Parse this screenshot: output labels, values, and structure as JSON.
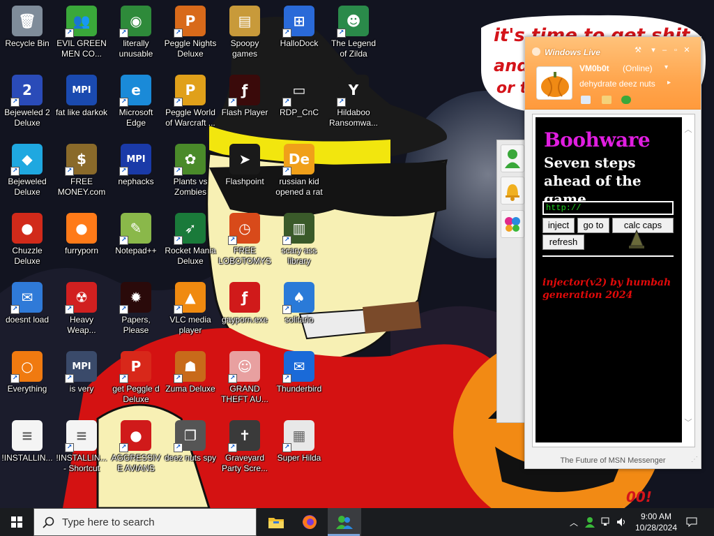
{
  "wallpaper": {
    "text": "it's time to get shit",
    "text_partial_1": "and",
    "text_partial_2": "or t",
    "halloween_text": "00!"
  },
  "desktop_icons": [
    {
      "label": "Recycle Bin",
      "icon": "recycle-bin-icon",
      "color": "#7f8c9a",
      "symbol": "🗑",
      "shortcut": false
    },
    {
      "label": "Bejeweled 2 Deluxe",
      "icon": "bejeweled-2-icon",
      "color": "#2a4bb8",
      "symbol": "2",
      "shortcut": true
    },
    {
      "label": "Bejeweled Deluxe",
      "icon": "bejeweled-icon",
      "color": "#1fa8e0",
      "symbol": "◆",
      "shortcut": true
    },
    {
      "label": "Chuzzle Deluxe",
      "icon": "chuzzle-icon",
      "color": "#d12a1a",
      "symbol": "●",
      "shortcut": false
    },
    {
      "label": "doesnt load",
      "icon": "thunderbird-icon",
      "color": "#2f7ad8",
      "symbol": "✉",
      "shortcut": true
    },
    {
      "label": "Everything",
      "icon": "everything-search-icon",
      "color": "#f07a10",
      "symbol": "○",
      "shortcut": true
    },
    {
      "label": "!INSTALLIN...",
      "icon": "text-file-icon",
      "color": "#f4f4f4",
      "symbol": "≡",
      "shortcut": false
    },
    {
      "label": "EVIL GREEN MEN CO...",
      "icon": "msn-people-icon",
      "color": "#3aa83a",
      "symbol": "👥",
      "shortcut": true
    },
    {
      "label": "fat like darkok",
      "icon": "mpi-icon",
      "color": "#1a4ab0",
      "symbol": "MPI",
      "shortcut": false
    },
    {
      "label": "FREE MONEY.com",
      "icon": "money-bag-icon",
      "color": "#8a6a2a",
      "symbol": "$",
      "shortcut": true
    },
    {
      "label": "furryporn",
      "icon": "firefox-icon",
      "color": "#ff7a18",
      "symbol": "●",
      "shortcut": false
    },
    {
      "label": "Heavy Weap...",
      "icon": "radiation-icon",
      "color": "#d12020",
      "symbol": "☢",
      "shortcut": true
    },
    {
      "label": "is very",
      "icon": "mpi-shield-icon",
      "color": "#3a4a6a",
      "symbol": "MPI",
      "shortcut": true
    },
    {
      "label": "!INSTALLIN... - Shortcut",
      "icon": "text-file-shortcut-icon",
      "color": "#f4f4f4",
      "symbol": "≡",
      "shortcut": true
    },
    {
      "label": "literally unusable",
      "icon": "chrome-icon",
      "color": "#2e8a3a",
      "symbol": "◉",
      "shortcut": true
    },
    {
      "label": "Microsoft Edge",
      "icon": "edge-icon",
      "color": "#1a8ad8",
      "symbol": "e",
      "shortcut": true
    },
    {
      "label": "nephacks",
      "icon": "mpi-logo-icon",
      "color": "#1a3aa8",
      "symbol": "MPI",
      "shortcut": true
    },
    {
      "label": "Notepad++",
      "icon": "notepad-plus-icon",
      "color": "#8ab84a",
      "symbol": "✎",
      "shortcut": true
    },
    {
      "label": "Papers, Please",
      "icon": "papers-please-icon",
      "color": "#2a0a0a",
      "symbol": "✹",
      "shortcut": true
    },
    {
      "label": "get Peggle d Deluxe",
      "icon": "peggle-icon",
      "color": "#d8281a",
      "symbol": "P",
      "shortcut": true
    },
    {
      "label": "AGGRESSIVE AVIANS",
      "icon": "angry-birds-icon",
      "color": "#d01a1a",
      "symbol": "●",
      "shortcut": true
    },
    {
      "label": "Peggle Nights Deluxe",
      "icon": "peggle-nights-icon",
      "color": "#d86a1a",
      "symbol": "P",
      "shortcut": true
    },
    {
      "label": "Peggle World of Warcraft ...",
      "icon": "peggle-wow-icon",
      "color": "#e0a01a",
      "symbol": "P",
      "shortcut": true
    },
    {
      "label": "Plants vs Zombies",
      "icon": "plants-vs-zombies-icon",
      "color": "#4a8a2a",
      "symbol": "✿",
      "shortcut": true
    },
    {
      "label": "Rocket Mania Deluxe",
      "icon": "rocket-mania-icon",
      "color": "#1a7a3a",
      "symbol": "➶",
      "shortcut": true
    },
    {
      "label": "VLC media player",
      "icon": "vlc-icon",
      "color": "#f08a10",
      "symbol": "▲",
      "shortcut": true
    },
    {
      "label": "Zuma Deluxe",
      "icon": "zuma-icon",
      "color": "#c86a1a",
      "symbol": "☗",
      "shortcut": true
    },
    {
      "label": "deez nuts spy",
      "icon": "stacked-windows-icon",
      "color": "#555555",
      "symbol": "❐",
      "shortcut": true
    },
    {
      "label": "Spoopy games",
      "icon": "games-folder-icon",
      "color": "#c89a3a",
      "symbol": "▤",
      "shortcut": false
    },
    {
      "label": "Flash Player",
      "icon": "flash-player-icon",
      "color": "#3a0a0a",
      "symbol": "ƒ",
      "shortcut": true
    },
    {
      "label": "Flashpoint",
      "icon": "flashpoint-icon",
      "color": "#1a1a1a",
      "symbol": "➤",
      "shortcut": false
    },
    {
      "label": "FREE LOBOTOMYS",
      "icon": "clock-icon",
      "color": "#d84a1a",
      "symbol": "◷",
      "shortcut": true
    },
    {
      "label": "gayporn.exe",
      "icon": "flash-exe-icon",
      "color": "#d01a1a",
      "symbol": "ƒ",
      "shortcut": false
    },
    {
      "label": "GRAND THEFT AU...",
      "icon": "anime-girl-icon",
      "color": "#e8a0a0",
      "symbol": "☺",
      "shortcut": true
    },
    {
      "label": "Graveyard Party Scre...",
      "icon": "graveyard-party-icon",
      "color": "#3a3a3a",
      "symbol": "✝",
      "shortcut": true
    },
    {
      "label": "HalloDock",
      "icon": "windows-shield-icon",
      "color": "#2a6ad8",
      "symbol": "⊞",
      "shortcut": true
    },
    {
      "label": "RDP_CnC",
      "icon": "rdp-icon",
      "color": "#1a1a1a",
      "symbol": "▭",
      "shortcut": true
    },
    {
      "label": "russian kid opened a rat",
      "icon": "dll-icon",
      "color": "#f0a01a",
      "symbol": "De",
      "shortcut": true
    },
    {
      "label": "scary ass library",
      "icon": "library-icon",
      "color": "#3a5a2a",
      "symbol": "▥",
      "shortcut": true
    },
    {
      "label": "solitario",
      "icon": "solitaire-icon",
      "color": "#2a7ad8",
      "symbol": "♠",
      "shortcut": true
    },
    {
      "label": "Thunderbird",
      "icon": "thunderbird-bird-icon",
      "color": "#1a6ad8",
      "symbol": "✉",
      "shortcut": true
    },
    {
      "label": "Super Hilda",
      "icon": "pixel-dog-icon",
      "color": "#e8e8e8",
      "symbol": "▦",
      "shortcut": true
    },
    {
      "label": "The Legend of Zilda",
      "icon": "zelda-character-icon",
      "color": "#2a8a4a",
      "symbol": "☻",
      "shortcut": true
    },
    {
      "label": "Hildaboo Ransomwa...",
      "icon": "yashma-ransomware-icon",
      "color": "#1a1a1a",
      "symbol": "Y",
      "shortcut": true
    }
  ],
  "messenger": {
    "brand": "Windows Live",
    "user_name": "VM0b0t",
    "status": "(Online)",
    "personal_message": "dehydrate deez nuts",
    "footer": "The Future of MSN Messenger",
    "colors": {
      "header": "#ffa64e",
      "title": "#e01ee0",
      "credit": "#e00a0a",
      "url": "#1fd11f"
    }
  },
  "boohware": {
    "title": "Boohware",
    "tagline": "Seven steps ahead of the game",
    "url_value": "http://",
    "buttons": {
      "inject": "inject",
      "goto": "go to",
      "calc_caps": "calc caps",
      "refresh": "refresh"
    },
    "credit": "injector(v2) by humbah generation 2024"
  },
  "taskbar": {
    "search_placeholder": "Type here to search",
    "clock_time": "9:00 AM",
    "clock_date": "10/28/2024",
    "pinned": [
      "file-explorer-icon",
      "firefox-icon",
      "msn-messenger-icon"
    ]
  }
}
